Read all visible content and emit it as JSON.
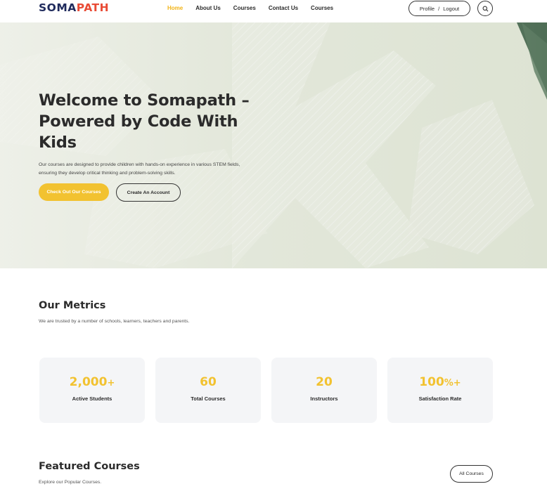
{
  "header": {
    "logo": {
      "part1": "SOMA",
      "part2": "PATH"
    },
    "nav": [
      "Home",
      "About Us",
      "Courses",
      "Contact Us",
      "Courses"
    ],
    "profile_label": "Profile",
    "separator": "/",
    "logout_label": "Logout",
    "search_icon": "search-icon"
  },
  "hero": {
    "title": "Welcome to Somapath – Powered by Code With Kids",
    "description": "Our courses are designed to provide children with hands-on experience in various STEM fields, ensuring they develop critical thinking and problem-solving skills.",
    "primary_button": "Check Out Our Courses",
    "secondary_button": "Create An Account"
  },
  "metrics": {
    "title": "Our Metrics",
    "subtitle": "We are trusted by a number of schools, learners, teachers and parents.",
    "items": [
      {
        "value": "2,000",
        "suffix": "+",
        "label": "Active Students"
      },
      {
        "value": "60",
        "suffix": "",
        "label": "Total Courses"
      },
      {
        "value": "20",
        "suffix": "",
        "label": "Instructors"
      },
      {
        "value": "100",
        "suffix": "%+",
        "label": "Satisfaction Rate"
      }
    ]
  },
  "featured": {
    "title": "Featured Courses",
    "subtitle": "Explore our Popular Courses.",
    "all_button": "All Courses"
  },
  "colors": {
    "accent": "#f2c230",
    "logo_dark": "#1f2a5c",
    "logo_red": "#e94b35",
    "text": "#2b2b2b"
  }
}
